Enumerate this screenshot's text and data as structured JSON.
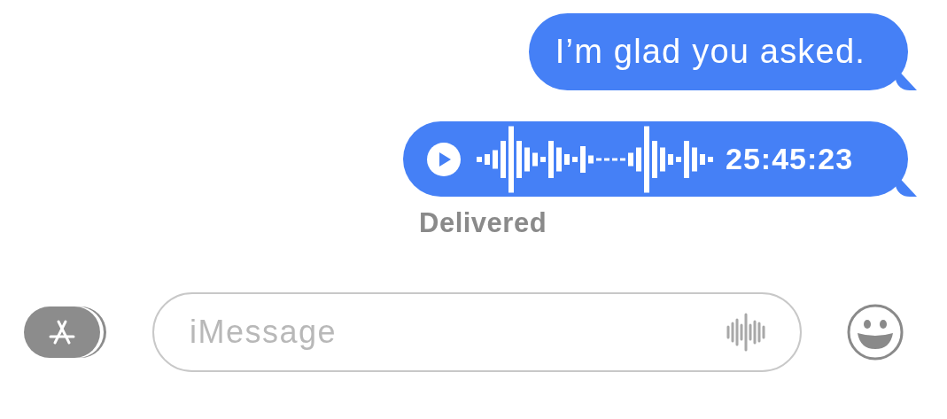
{
  "messages": [
    {
      "kind": "text",
      "text": "I’m glad you asked."
    },
    {
      "kind": "audio",
      "duration": "25:45:23"
    }
  ],
  "status": "Delivered",
  "composer": {
    "placeholder": "iMessage"
  }
}
